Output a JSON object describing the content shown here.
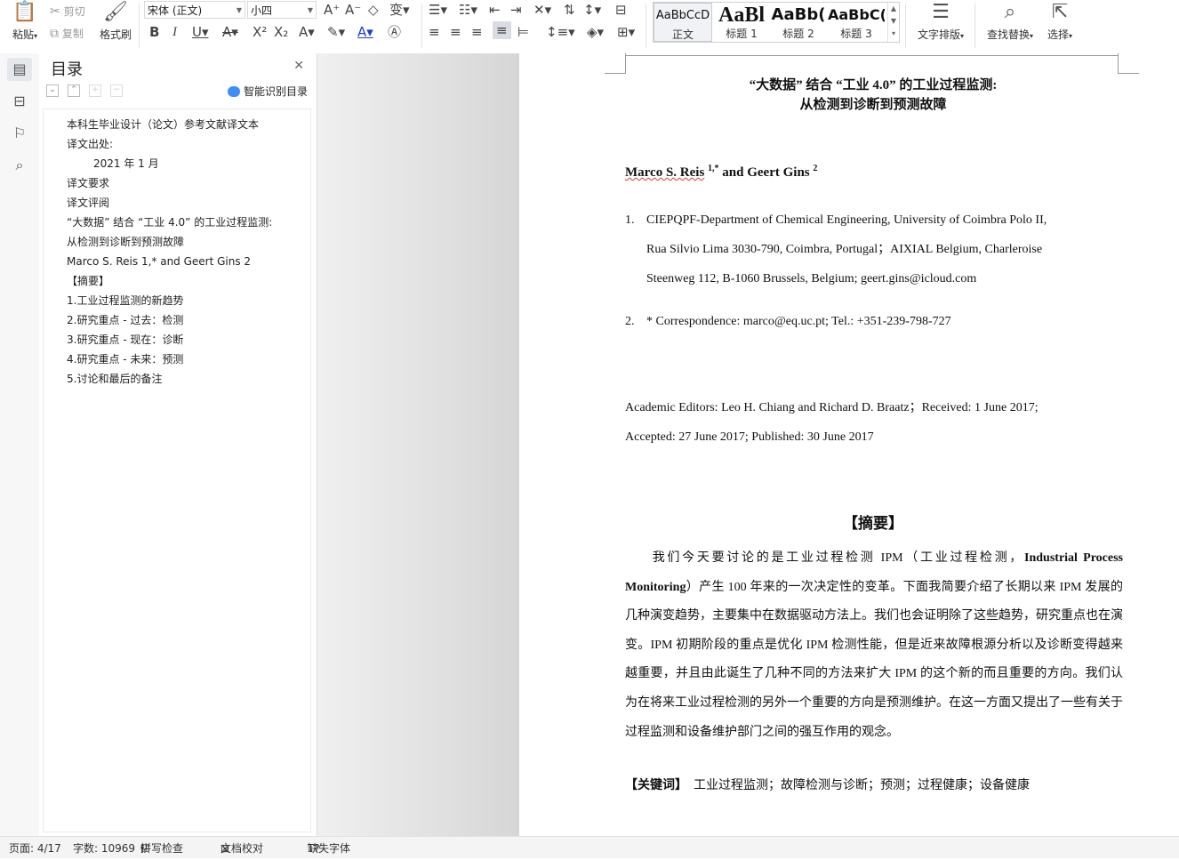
{
  "ribbon": {
    "paste_label": "粘贴",
    "cut_label": "剪切",
    "copy_label": "复制",
    "format_painter_label": "格式刷",
    "font_name": "宋体 (正文)",
    "font_size": "小四",
    "styles": [
      {
        "sample": "AaBbCcD",
        "name": "正文"
      },
      {
        "sample": "AaBl",
        "name": "标题 1"
      },
      {
        "sample": "AaBb(",
        "name": "标题 2"
      },
      {
        "sample": "AaBbC(",
        "name": "标题 3"
      }
    ],
    "text_layout_label": "文字排版",
    "find_replace_label": "查找替换",
    "select_label": "选择"
  },
  "toc": {
    "title": "目录",
    "smart_label": "智能识别目录",
    "items": [
      {
        "text": "本科生毕业设计（论文）参考文献译文本",
        "indent": 0
      },
      {
        "text": "译文出处:",
        "indent": 0
      },
      {
        "text": "2021 年 1 月",
        "indent": 1
      },
      {
        "text": "译文要求",
        "indent": 0
      },
      {
        "text": "译文评阅",
        "indent": 0
      },
      {
        "text": "“大数据” 结合 “工业 4.0” 的工业过程监测:",
        "indent": 0
      },
      {
        "text": "从检测到诊断到预测故障",
        "indent": 0
      },
      {
        "text": "Marco S. Reis 1,* and Geert Gins 2",
        "indent": 0
      },
      {
        "text": "【摘要】",
        "indent": 0
      },
      {
        "text": "1.工业过程监测的新趋势",
        "indent": 0
      },
      {
        "text": "2.研究重点 - 过去：检测",
        "indent": 0
      },
      {
        "text": "3.研究重点 - 现在：诊断",
        "indent": 0
      },
      {
        "text": "4.研究重点 - 未来：预测",
        "indent": 0
      },
      {
        "text": "5.讨论和最后的备注",
        "indent": 0
      }
    ]
  },
  "doc": {
    "title_line1": "“大数据” 结合 “工业 4.0” 的工业过程监测:",
    "title_line2": "从检测到诊断到预测故障",
    "author_a": "Marco S. Reis",
    "author_a_sup": "1,*",
    "author_and": " and Geert Gins",
    "author_b_sup": "2",
    "aff1_num": "1.",
    "aff1_l1": "CIEPQPF-Department of Chemical Engineering, University of Coimbra Polo II,",
    "aff1_l2": "Rua Silvio Lima 3030-790, Coimbra, Portugal；AIXIAL Belgium, Charleroise",
    "aff1_l3": "Steenweg 112, B-1060 Brussels, Belgium; geert.gins@icloud.com",
    "aff2_num": "2.",
    "aff2_l1": "* Correspondence: marco@eq.uc.pt; Tel.: +351-239-798-727",
    "editors_l1": "Academic Editors: Leo H. Chiang and Richard D. Braatz；Received: 1 June 2017;",
    "editors_l2": "Accepted: 27 June 2017; Published: 30 June 2017",
    "abstract_heading": "【摘要】",
    "abstract_pre": "我们今天要讨论的是工业过程检测 IPM（工业过程检测，",
    "abstract_bold": "Industrial Process Monitoring",
    "abstract_post": "）产生 100 年来的一次决定性的变革。下面我简要介绍了长期以来 IPM 发展的几种演变趋势，主要集中在数据驱动方法上。我们也会证明除了这些趋势，研究重点也在演变。IPM 初期阶段的重点是优化 IPM 检测性能，但是近来故障根源分析以及诊断变得越来越重要，并且由此诞生了几种不同的方法来扩大 IPM 的这个新的而且重要的方向。我们认为在将来工业过程检测的另外一个重要的方向是预测维护。在这一方面又提出了一些有关于过程监测和设备维护部门之间的强互作用的观念。",
    "keywords_label": "【关键词】",
    "keywords_text": "工业过程监测；故障检测与诊断；预测；过程健康；设备健康"
  },
  "status": {
    "page": "页面: 4/17",
    "words": "字数: 10969",
    "spell": "拼写检查",
    "proof": "文档校对",
    "missing_font": "缺失字体"
  }
}
